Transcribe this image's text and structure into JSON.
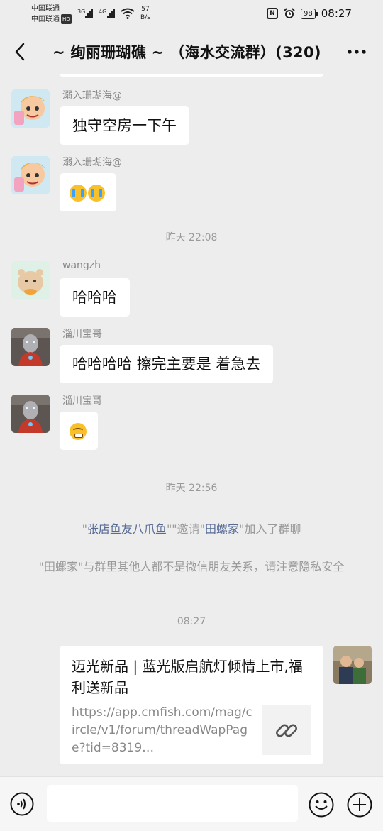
{
  "status_bar": {
    "carrier_1": "中国联通",
    "carrier_2": "中国联通",
    "carrier_2_badge": "HD",
    "net_1": "3G",
    "net_2": "4G",
    "speed_value": "57",
    "speed_unit": "B/s",
    "nfc": "N",
    "battery": "98",
    "time": "08:27"
  },
  "header": {
    "back_glyph": "‹",
    "title": "~ 绚丽珊瑚礁 ~ （海水交流群）(320)",
    "more_glyph": "···"
  },
  "messages": [
    {
      "sender": "溺入珊瑚海@",
      "text": "独守空房一下午"
    },
    {
      "sender": "溺入珊瑚海@",
      "emoji": "crying-face x2"
    },
    {
      "time": "昨天 22:08"
    },
    {
      "sender": "wangzh",
      "text": "哈哈哈"
    },
    {
      "sender": "淄川宝哥",
      "text": "哈哈哈哈 擦完主要是 着急去"
    },
    {
      "sender": "淄川宝哥",
      "emoji": "grimacing-face"
    },
    {
      "time": "昨天 22:56"
    }
  ],
  "system": {
    "invite": {
      "inviter": "张店鱼友八爪鱼",
      "q1_open": "\"",
      "q1_close": "\"",
      "verb": "邀请",
      "verb_q_open": "\"",
      "verb_q_close": "\"",
      "invitee": "田螺家",
      "suffix": "加入了群聊"
    },
    "notice_open": "\"",
    "notice_name": "田螺家",
    "notice_text": "\"与群里其他人都不是微信朋友关系，请注意隐私安全"
  },
  "time_3": "08:27",
  "link_card": {
    "title": "迈光新品 | 蓝光版启航灯倾情上市,福利送新品",
    "url": "https://app.cmfish.com/mag/circle/v1/forum/threadWapPage?tid=8319…",
    "thumb_icon": "link-icon"
  },
  "input_bar": {
    "voice_icon": "voice-icon",
    "emoji_icon": "emoji-icon",
    "plus_icon": "plus-icon",
    "text_value": ""
  },
  "colors": {
    "background": "#ededed",
    "bubble": "#ffffff",
    "link_text": "#576b95",
    "muted_text": "#9a9a9a"
  }
}
